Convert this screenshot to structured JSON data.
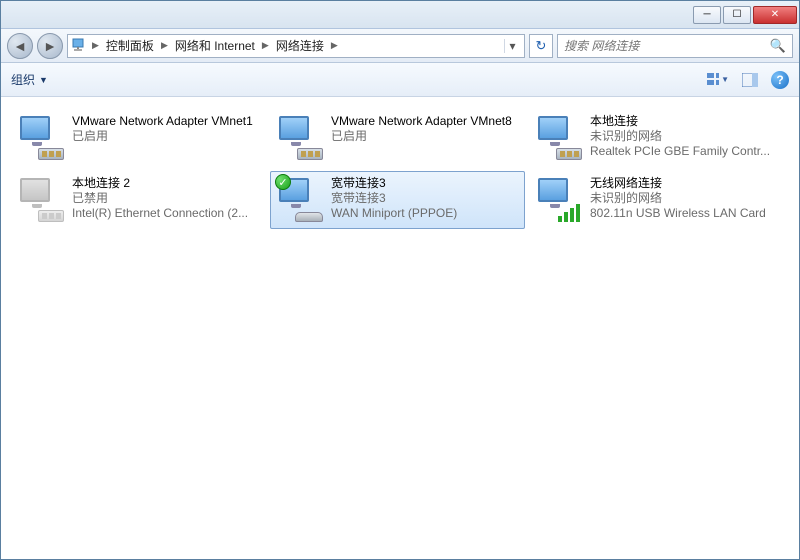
{
  "breadcrumbs": [
    "控制面板",
    "网络和 Internet",
    "网络连接"
  ],
  "search": {
    "placeholder": "搜索 网络连接"
  },
  "toolbar": {
    "organize": "组织"
  },
  "items": [
    {
      "name": "VMware Network Adapter VMnet1",
      "status": "已启用",
      "device": "",
      "icon": "nic"
    },
    {
      "name": "VMware Network Adapter VMnet8",
      "status": "已启用",
      "device": "",
      "icon": "nic"
    },
    {
      "name": "本地连接",
      "status": "未识别的网络",
      "device": "Realtek PCIe GBE Family Contr...",
      "icon": "nic"
    },
    {
      "name": "本地连接 2",
      "status": "已禁用",
      "device": "Intel(R) Ethernet Connection (2...",
      "icon": "nic",
      "disabled": true
    },
    {
      "name": "宽带连接3",
      "status": "宽带连接3",
      "device": "WAN Miniport (PPPOE)",
      "icon": "modem",
      "badge": "check",
      "selected": true
    },
    {
      "name": "无线网络连接",
      "status": "未识别的网络",
      "device": "802.11n USB Wireless LAN Card",
      "icon": "wifi"
    }
  ]
}
